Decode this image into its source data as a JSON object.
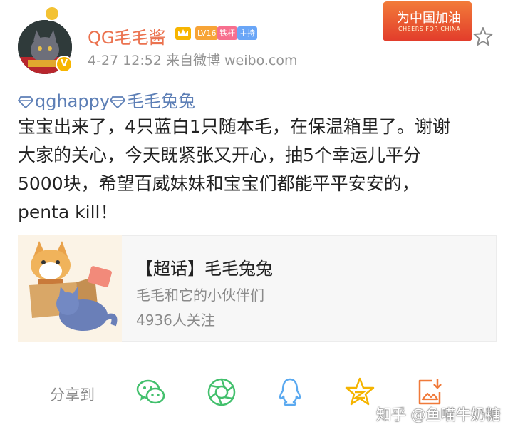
{
  "post": {
    "author": {
      "name": "QG毛毛酱",
      "level_tag": "LV16",
      "fan_tag": "铁杆",
      "host_tag": "主持",
      "vip_mark": "V"
    },
    "meta": "4-27 12:52  来自微博 weibo.com",
    "cheer_banner": {
      "text": "为中国加油",
      "subtext": "CHEERS FOR CHINA"
    },
    "mentions": [
      "qghappy",
      "毛毛兔兔"
    ],
    "text_lines": [
      "宝宝出来了，4只蓝白1只随本毛，在保温箱里了。谢谢",
      "大家的关心，今天既紧张又开心，抽5个幸运儿平分",
      "5000块，希望百威妹妹和宝宝们都能平平安安的，",
      "penta kill！"
    ]
  },
  "topic_card": {
    "title": "【超话】毛毛兔兔",
    "subtitle": "毛毛和它的小伙伴们",
    "followers": "4936人关注"
  },
  "share_bar": {
    "label": "分享到",
    "targets": [
      "wechat-icon",
      "moments-icon",
      "qq-icon",
      "qzone-icon",
      "save-image-icon"
    ]
  },
  "watermark": "知乎 @鱼喵牛奶糖",
  "colors": {
    "username": "#eb7350",
    "link": "#5d7fb6",
    "share_icon": "#43c06d",
    "qq_icon": "#5aa9f0",
    "qzone_icon": "#f5b400",
    "save_icon": "#f07a3a"
  }
}
